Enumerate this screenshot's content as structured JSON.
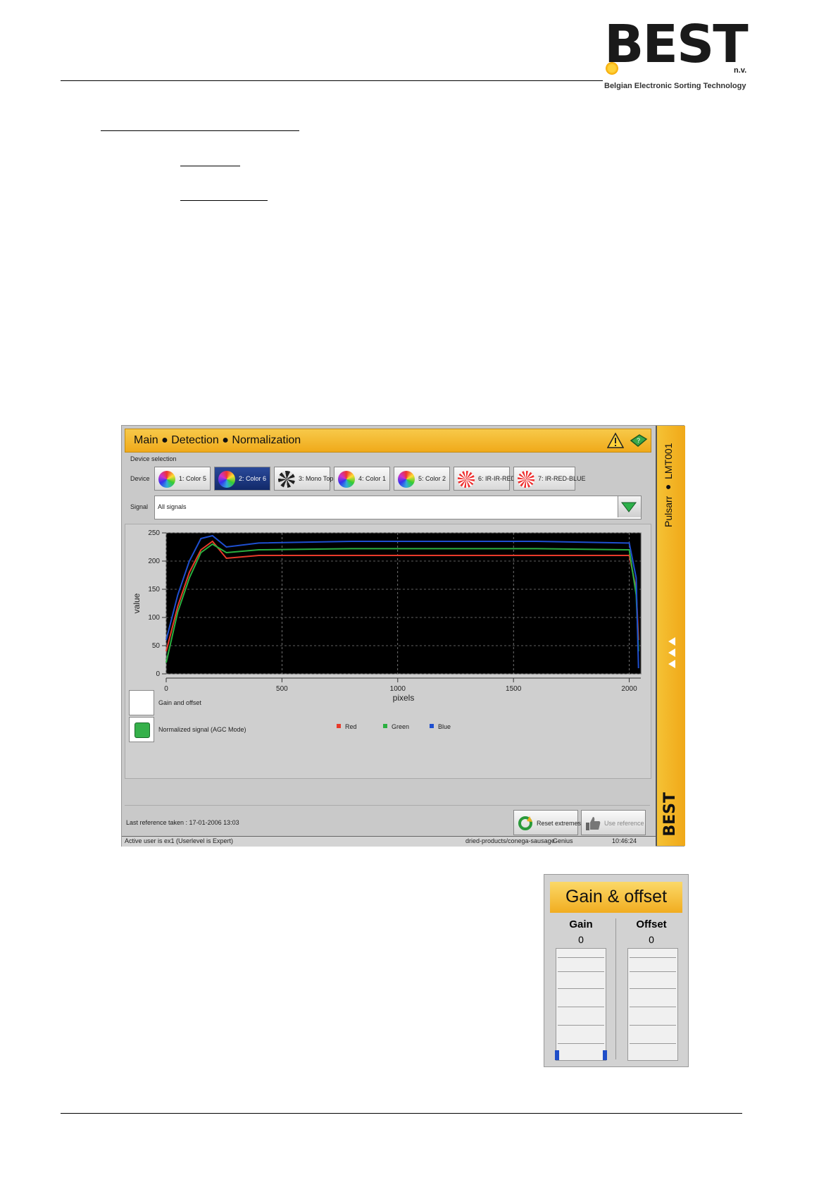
{
  "logo": {
    "brand": "BEST",
    "suffix": "n.v.",
    "tagline": "Belgian Electronic Sorting Technology"
  },
  "app": {
    "breadcrumb": "Main ● Detection ● Normalization",
    "side_label": "Pulsarr ● LMT001",
    "side_logo": "BEST",
    "device_selection_label": "Device selection",
    "device_label": "Device",
    "devices": [
      {
        "label": "1: Color 5",
        "icon": "color-wheel-icon"
      },
      {
        "label": "2: Color 6",
        "icon": "color-wheel-icon"
      },
      {
        "label": "3: Mono Top",
        "icon": "mono-wheel-icon"
      },
      {
        "label": "4: Color 1",
        "icon": "color-wheel-icon"
      },
      {
        "label": "5: Color 2",
        "icon": "color-wheel-icon"
      },
      {
        "label": "6: IR-IR-RED",
        "icon": "ir-wheel-icon"
      },
      {
        "label": "7: IR-RED-BLUE",
        "icon": "ir-wheel-icon"
      }
    ],
    "selected_device": 1,
    "signal_label": "Signal",
    "signal_value": "All signals",
    "checkboxes": [
      {
        "label": "Gain and offset",
        "checked": false
      },
      {
        "label": "Normalized signal (AGC Mode)",
        "checked": true
      }
    ],
    "last_reference": "Last reference taken :  17-01-2006 13:03",
    "reset_label": "Reset extremes",
    "use_reference_label": "Use reference",
    "status": {
      "user": "Active user is ex1 (Userlevel is Expert)",
      "product": "dried-products/conega-sausage",
      "mode": "Genius",
      "time": "10:46:24"
    }
  },
  "chart_data": {
    "type": "line",
    "xlabel": "pixels",
    "ylabel": "value",
    "xlim": [
      0,
      2050
    ],
    "ylim": [
      0,
      250
    ],
    "xticks": [
      0,
      500,
      1000,
      1500,
      2000
    ],
    "yticks": [
      0,
      50,
      100,
      150,
      200,
      250
    ],
    "grid": true,
    "legend_position": "bottom",
    "series": [
      {
        "name": "Red",
        "color": "#e83a2a",
        "x": [
          0,
          50,
          100,
          150,
          200,
          260,
          400,
          800,
          1200,
          1600,
          2000,
          2030,
          2040
        ],
        "y": [
          40,
          120,
          180,
          220,
          235,
          205,
          210,
          210,
          210,
          210,
          210,
          150,
          60
        ]
      },
      {
        "name": "Green",
        "color": "#2ab040",
        "x": [
          0,
          50,
          100,
          150,
          200,
          260,
          400,
          800,
          1200,
          1600,
          2000,
          2030,
          2040
        ],
        "y": [
          20,
          110,
          170,
          215,
          230,
          215,
          220,
          222,
          222,
          222,
          220,
          140,
          40
        ]
      },
      {
        "name": "Blue",
        "color": "#1e4fd0",
        "x": [
          0,
          50,
          100,
          150,
          200,
          260,
          400,
          800,
          1200,
          1600,
          2000,
          2030,
          2040
        ],
        "y": [
          60,
          140,
          200,
          240,
          245,
          225,
          232,
          235,
          235,
          235,
          232,
          170,
          10
        ]
      }
    ]
  },
  "gain_offset": {
    "title": "Gain & offset",
    "gain_label": "Gain",
    "gain_value": "0",
    "offset_label": "Offset",
    "offset_value": "0"
  }
}
